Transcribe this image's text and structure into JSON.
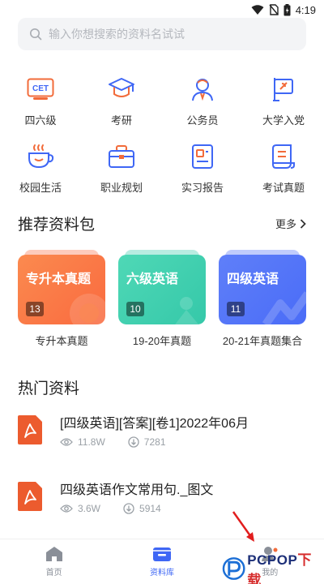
{
  "status": {
    "time": "4:19"
  },
  "search": {
    "placeholder": "输入你想搜索的资料名试试"
  },
  "categories": [
    {
      "label": "四六级",
      "icon": "cet-icon",
      "icon_text": "CET"
    },
    {
      "label": "考研",
      "icon": "graduation-cap-icon"
    },
    {
      "label": "公务员",
      "icon": "civil-servant-icon"
    },
    {
      "label": "大学入党",
      "icon": "party-flag-icon"
    },
    {
      "label": "校园生活",
      "icon": "cup-icon"
    },
    {
      "label": "职业规划",
      "icon": "briefcase-icon"
    },
    {
      "label": "实习报告",
      "icon": "id-card-icon"
    },
    {
      "label": "考试真题",
      "icon": "exam-paper-icon"
    }
  ],
  "recommend": {
    "title": "推荐资料包",
    "more_label": "更多",
    "packs": [
      {
        "title": "专升本真题",
        "count": "13",
        "caption": "专升本真题",
        "color": "#f96a3f",
        "color2": "#fb8a4f"
      },
      {
        "title": "六级英语",
        "count": "10",
        "caption": "19-20年真题",
        "color": "#35c8a9",
        "color2": "#4fd8b6"
      },
      {
        "title": "四级英语",
        "count": "11",
        "caption": "20-21年真题集合",
        "color": "#4a6cf7",
        "color2": "#5f7ff9"
      }
    ]
  },
  "hot": {
    "title": "热门资料",
    "items": [
      {
        "title": "[四级英语][答案][卷1]2022年06月",
        "views": "11.8W",
        "downloads": "7281"
      },
      {
        "title": "四级英语作文常用句._图文",
        "views": "3.6W",
        "downloads": "5914"
      }
    ]
  },
  "nav": [
    {
      "label": "首页",
      "icon": "home-icon",
      "active": false
    },
    {
      "label": "资料库",
      "icon": "library-icon",
      "active": true
    },
    {
      "label": "我的",
      "icon": "profile-icon",
      "active": false
    }
  ],
  "watermark": {
    "text_a": "PCPOP",
    "text_b": "下载"
  },
  "colors": {
    "accent": "#3f67f5",
    "icon_orange": "#f26b3a",
    "pdf_red": "#ec5b2e"
  }
}
